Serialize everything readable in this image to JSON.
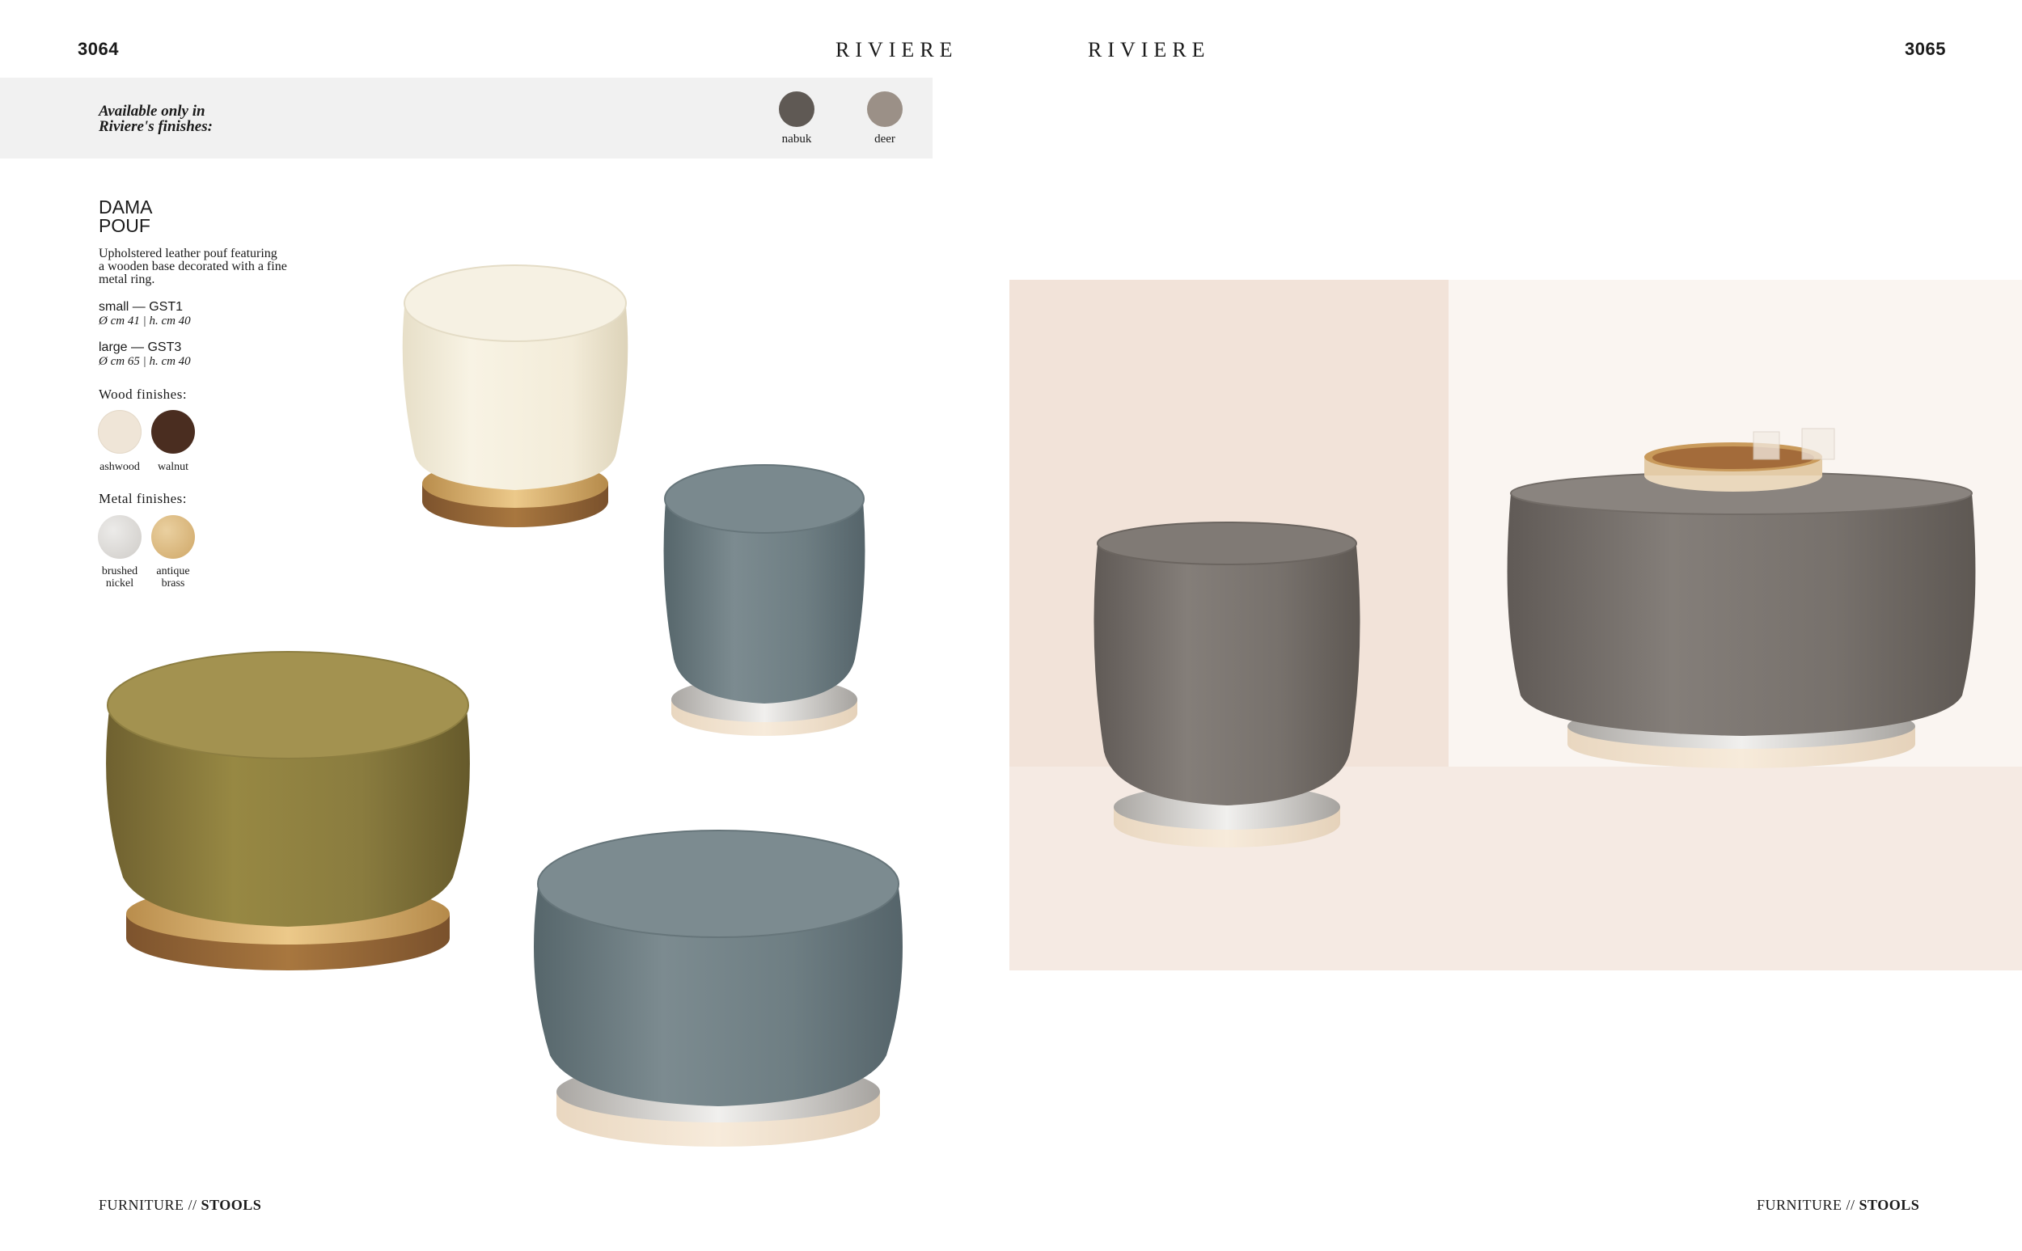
{
  "header": {
    "left_page_number": "3064",
    "right_page_number": "3065",
    "brand_left": "RIVIERE",
    "brand_right": "RIVIERE"
  },
  "availability": {
    "text_line1": "Available only in",
    "text_line2": "Riviere's finishes:",
    "swatches": [
      {
        "label": "nabuk",
        "color": "#5f5954"
      },
      {
        "label": "deer",
        "color": "#9b9087"
      }
    ]
  },
  "product": {
    "title_line1": "DAMA",
    "title_line2": "POUF",
    "description_line1": "Upholstered leather pouf featuring",
    "description_line2": "a wooden base decorated with a fine",
    "description_line3": "metal ring.",
    "variants": [
      {
        "name": "small — GST1",
        "dims": "Ø cm 41 | h. cm 40"
      },
      {
        "name": "large — GST3",
        "dims": "Ø cm 65 | h. cm 40"
      }
    ],
    "wood_finishes_label": "Wood finishes:",
    "wood_finishes": [
      {
        "label": "ashwood",
        "color": "#efe5d7"
      },
      {
        "label": "walnut",
        "color": "#4a2d20"
      }
    ],
    "metal_finishes_label": "Metal finishes:",
    "metal_finishes": [
      {
        "label_line1": "brushed",
        "label_line2": "nickel",
        "color": "#dcdad7"
      },
      {
        "label_line1": "antique",
        "label_line2": "brass",
        "color": "#d9b982"
      }
    ]
  },
  "footer": {
    "left_category": "FURNITURE",
    "left_separator": " // ",
    "left_subcategory": "STOOLS",
    "right_category": "FURNITURE",
    "right_separator": " // ",
    "right_subcategory": "STOOLS"
  },
  "colors": {
    "band": "#f1f1f1",
    "cream_leather": "#f3edda",
    "olive_velvet": "#8c7d40",
    "blue_grey_velvet": "#6f8086",
    "grey_velvet": "#77716c",
    "walnut_base": "#9a6a3e",
    "ash_base": "#f0e2cf",
    "brass_ring": "#d3ae6b",
    "nickel_ring": "#c9c6c2",
    "room_wall": "#f2e6de"
  }
}
